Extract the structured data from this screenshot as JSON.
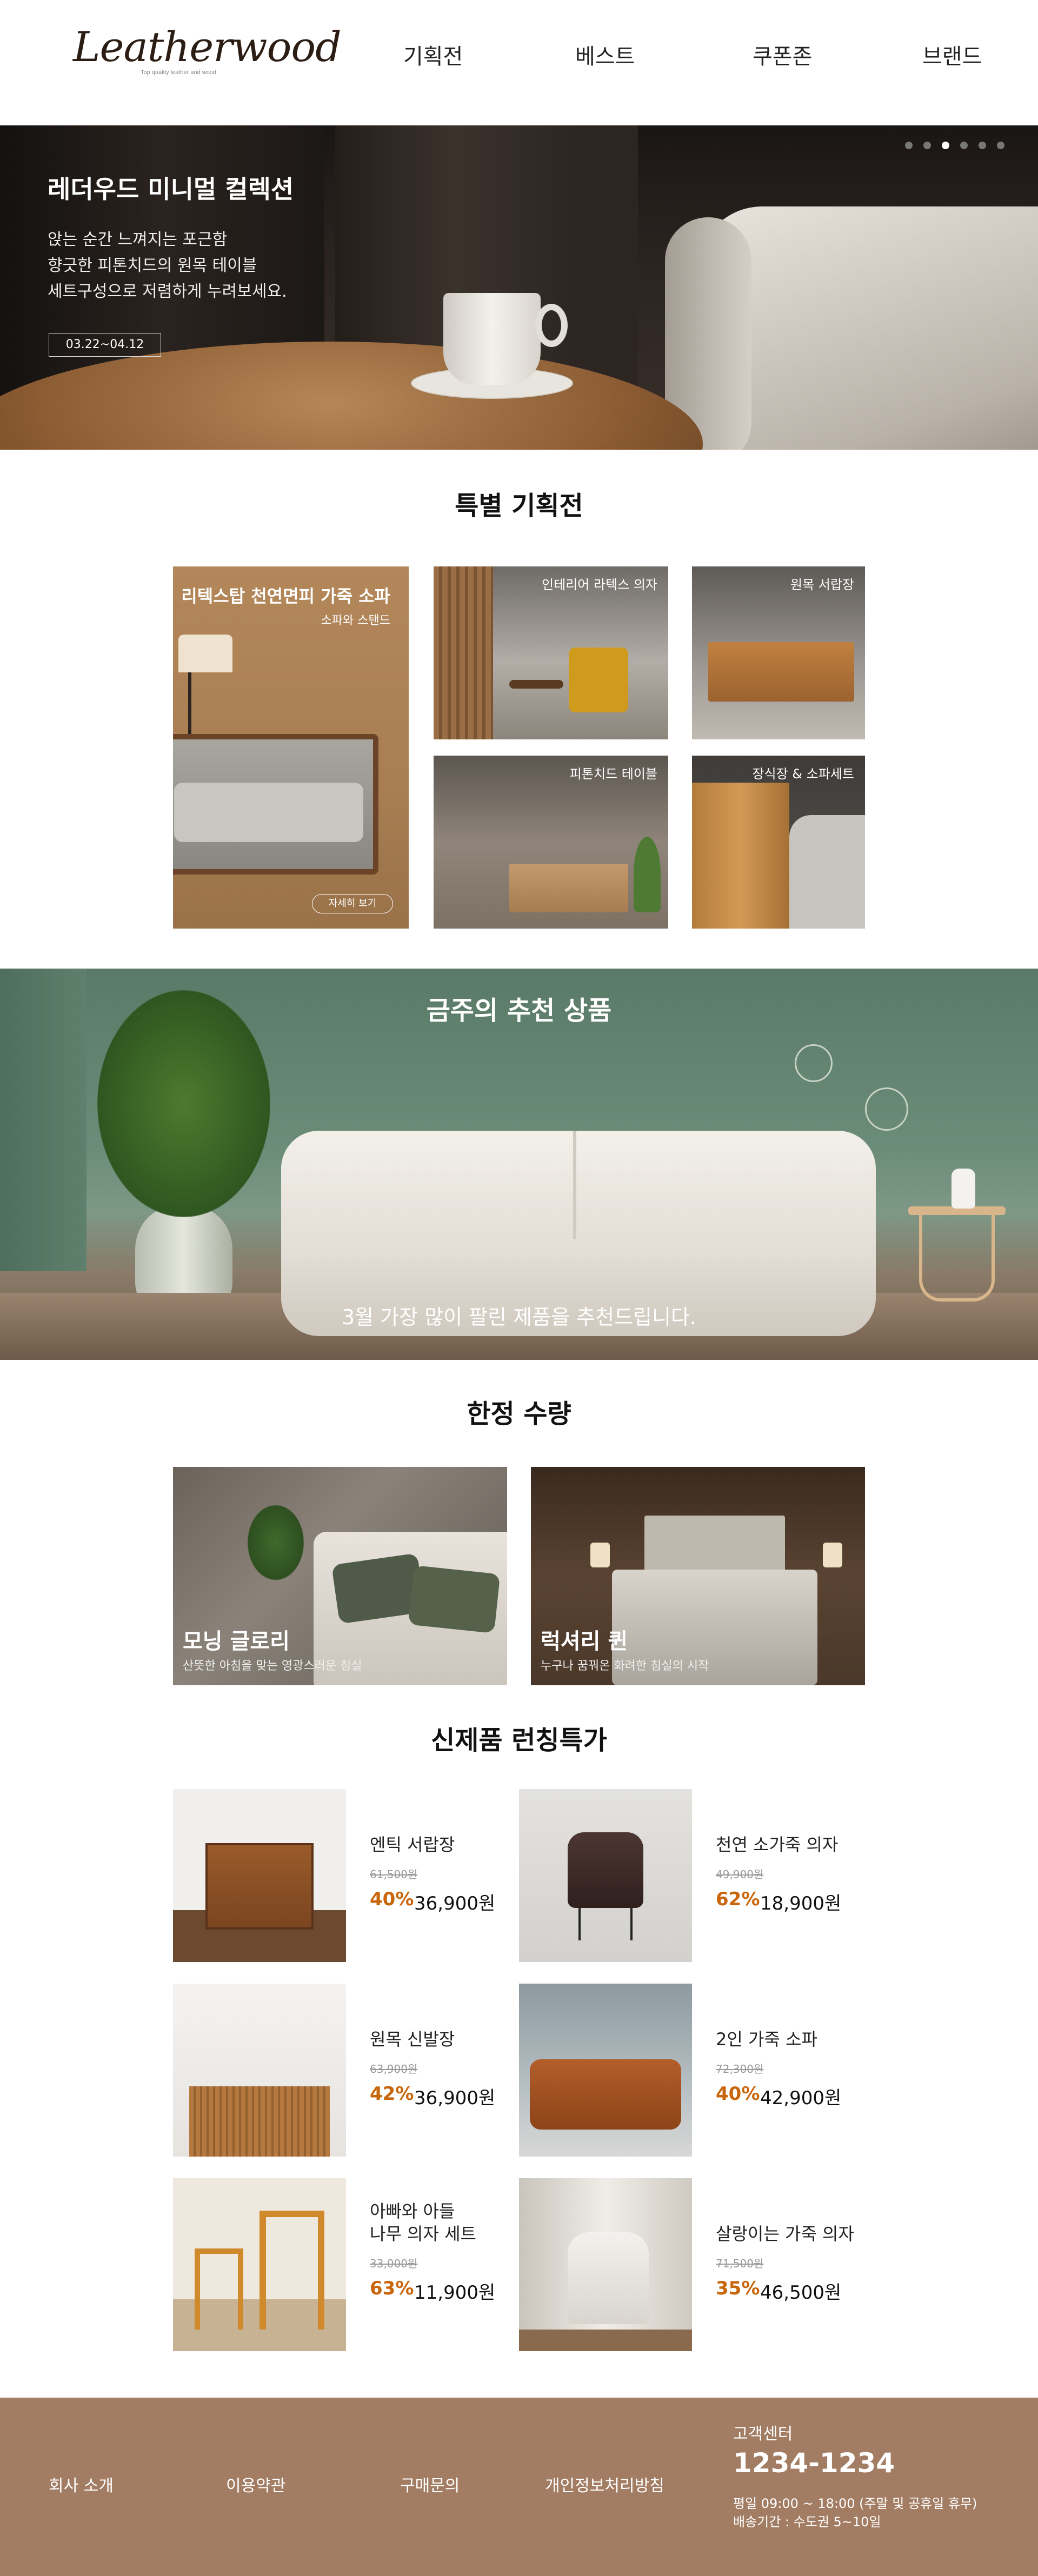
{
  "header": {
    "logo": "Leatherwood",
    "tagline": "Top quality leather and wood",
    "nav": [
      "기획전",
      "베스트",
      "쿠폰존",
      "브랜드"
    ]
  },
  "hero": {
    "title": "레더우드 미니멀 컬렉션",
    "lines": [
      "앉는 순간 느껴지는 포근함",
      "향긋한 피톤치드의 원목 테이블",
      "세트구성으로 저렴하게 누려보세요."
    ],
    "date": "03.22~04.12",
    "slides_total": 6,
    "slide_active": 3
  },
  "special": {
    "title": "특별 기획전",
    "main": {
      "title": "리텍스탑 천연면피 가죽 소파",
      "sub": "소파와 스탠드",
      "button": "자세히 보기"
    },
    "tiles": [
      "인테리어 라텍스 의자",
      "원목 서랍장",
      "피톤치드 테이블",
      "장식장 & 소파세트"
    ]
  },
  "recommend": {
    "title": "금주의 추천 상품",
    "caption": "3월 가장 많이 팔린 제품을 추천드립니다."
  },
  "limited": {
    "title": "한정 수량",
    "cards": [
      {
        "name": "모닝 글로리",
        "sub": "산뜻한 아침을 맞는 영광스러운 침실"
      },
      {
        "name": "럭셔리 퀸",
        "sub": "누구나 꿈꿔온 화려한 침실의 시작"
      }
    ]
  },
  "launch": {
    "title": "신제품 런칭특가",
    "products": [
      {
        "name": "엔틱 서랍장",
        "orig": "61,500원",
        "disc": "40%",
        "price": "36,900원"
      },
      {
        "name": "천연 소가죽 의자",
        "orig": "49,900원",
        "disc": "62%",
        "price": "18,900원"
      },
      {
        "name": "원목 신발장",
        "orig": "63,900원",
        "disc": "42%",
        "price": "36,900원"
      },
      {
        "name": "2인 가죽 소파",
        "orig": "72,300원",
        "disc": "40%",
        "price": "42,900원"
      },
      {
        "name": "아빠와 아들\n나무 의자 세트",
        "orig": "33,000원",
        "disc": "63%",
        "price": "11,900원"
      },
      {
        "name": "살랑이는 가죽 의자",
        "orig": "71,500원",
        "disc": "35%",
        "price": "46,500원"
      }
    ]
  },
  "footer": {
    "links": [
      "회사 소개",
      "이용약관",
      "구매문의",
      "개인정보처리방침"
    ],
    "cs_title": "고객센터",
    "phone": "1234-1234",
    "hours": "평일 09:00 ~ 18:00 (주말 및 공휴일 휴무)",
    "shipping": "배송기간 : 수도권 5~10일"
  }
}
